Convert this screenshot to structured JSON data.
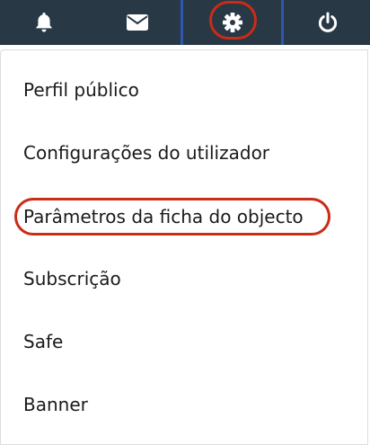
{
  "topbar": {
    "icons": [
      "bell-icon",
      "envelope-icon",
      "gear-icon",
      "power-icon"
    ],
    "active": "gear-icon",
    "background": "#283845",
    "active_border_color": "#2f56b0"
  },
  "menu": {
    "items": [
      {
        "label": "Perfil público"
      },
      {
        "label": "Configurações do utilizador"
      },
      {
        "label": "Parâmetros da ficha do objecto"
      },
      {
        "label": "Subscrição"
      },
      {
        "label": "Safe"
      },
      {
        "label": "Banner"
      }
    ],
    "highlighted_index": 2
  },
  "annotation_color": "#c92c17"
}
